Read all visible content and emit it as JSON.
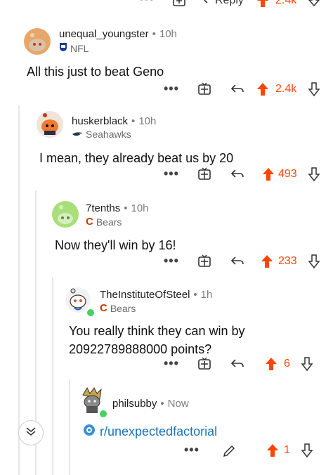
{
  "top_partial": {
    "more": "•••",
    "reply_label": "Reply",
    "score": "2.4k"
  },
  "comments": [
    {
      "username": "unequal_youngster",
      "age": "10h",
      "flair": "NFL",
      "body": "All this just to beat Geno",
      "score": "2.4k",
      "more": "•••"
    },
    {
      "username": "huskerblack",
      "age": "10h",
      "flair": "Seahawks",
      "body": "I mean, they already beat us by 20",
      "score": "493",
      "more": "•••"
    },
    {
      "username": "7tenths",
      "age": "10h",
      "flair": "Bears",
      "body": "Now they'll win by 16!",
      "score": "233",
      "more": "•••"
    },
    {
      "username": "TheInstituteOfSteel",
      "age": "1h",
      "flair": "Bears",
      "body_line1": "You really think they can win by",
      "body_line2": "20922789888000 points?",
      "score": "6",
      "more": "•••"
    },
    {
      "username": "philsubby",
      "age": "Now",
      "link": "r/unexpectedfactorial",
      "score": "1",
      "more": "•••"
    }
  ],
  "dot": "•",
  "colors": {
    "upvote": "#ff4500",
    "link": "#1a73b8",
    "thread": "#e6e6e6"
  }
}
